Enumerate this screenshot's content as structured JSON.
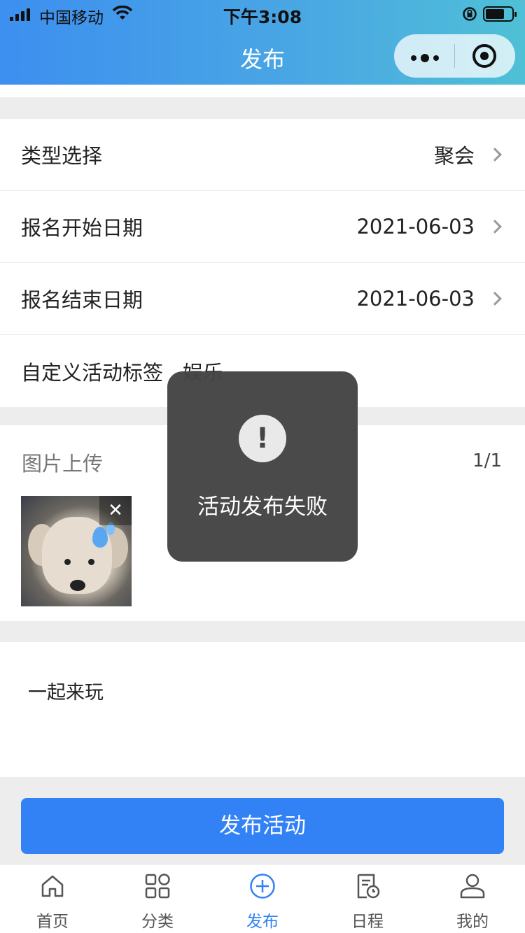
{
  "status_bar": {
    "carrier": "中国移动",
    "time": "下午3:08"
  },
  "nav": {
    "title": "发布"
  },
  "form": {
    "type": {
      "label": "类型选择",
      "value": "聚会"
    },
    "start_date": {
      "label": "报名开始日期",
      "value": "2021-06-03"
    },
    "end_date": {
      "label": "报名结束日期",
      "value": "2021-06-03"
    },
    "tag": {
      "label": "自定义活动标签",
      "value": "娱乐"
    }
  },
  "upload": {
    "title": "图片上传",
    "count": "1/1",
    "close_symbol": "✕"
  },
  "description": {
    "text": "一起来玩"
  },
  "publish_button": {
    "label": "发布活动"
  },
  "toast": {
    "icon": "!",
    "message": "活动发布失败"
  },
  "tabbar": {
    "items": [
      {
        "label": "首页",
        "icon": "home-icon"
      },
      {
        "label": "分类",
        "icon": "grid-icon"
      },
      {
        "label": "发布",
        "icon": "plus-circle-icon",
        "active": true
      },
      {
        "label": "日程",
        "icon": "schedule-icon"
      },
      {
        "label": "我的",
        "icon": "user-icon"
      }
    ]
  },
  "colors": {
    "accent": "#3281f5",
    "header_start": "#3d8ff0",
    "header_end": "#4fc0d6",
    "toast_bg": "#444444"
  }
}
